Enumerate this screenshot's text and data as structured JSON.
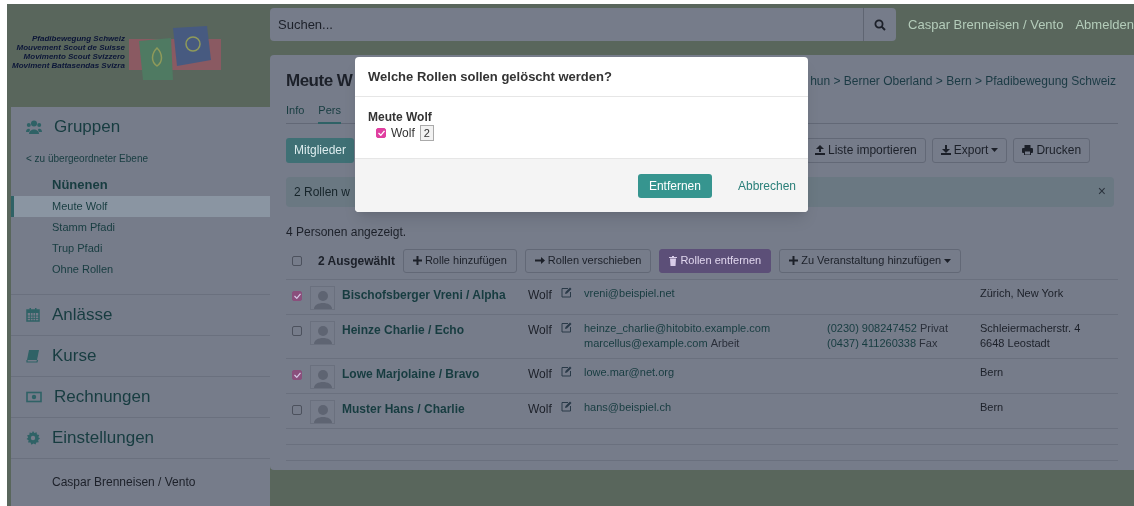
{
  "header": {
    "search_placeholder": "Suchen...",
    "user": "Caspar Brenneisen / Vento",
    "logout": "Abmelden"
  },
  "logo": {
    "lines": [
      "Pfadibewegung Schweiz",
      "Mouvement Scout de Suisse",
      "Movimento Scout Svizzero",
      "Moviment Battasendas Svizra"
    ]
  },
  "sidebar": {
    "sections": [
      {
        "kind": "groups",
        "title": "Gruppen",
        "back_link": "< zu übergeordneter Ebene",
        "items": [
          {
            "label": "Nünenen",
            "kind": "parent",
            "selected": false
          },
          {
            "label": "Meute Wolf",
            "kind": "child",
            "selected": true
          },
          {
            "label": "Stamm Pfadi",
            "kind": "child",
            "selected": false
          },
          {
            "label": "Trup Pfadi",
            "kind": "child",
            "selected": false
          },
          {
            "label": "Ohne Rollen",
            "kind": "child",
            "selected": false
          }
        ]
      },
      {
        "kind": "events",
        "title": "Anlässe"
      },
      {
        "kind": "courses",
        "title": "Kurse"
      },
      {
        "kind": "invoices",
        "title": "Rechnungen"
      },
      {
        "kind": "settings",
        "title": "Einstellungen"
      }
    ],
    "footer_user": "Caspar Brenneisen / Vento"
  },
  "main": {
    "title": "Meute W",
    "breadcrumb": "hun > Berner Oberland > Bern > Pfadibewegung Schweiz",
    "tabs": [
      {
        "label": "Info",
        "selected": false
      },
      {
        "label": "Pers",
        "selected": true
      }
    ],
    "actions": [
      {
        "label": "Mitglieder",
        "kind": "primary"
      },
      {
        "label": "Liste importieren",
        "kind": "import"
      },
      {
        "label": "Export",
        "kind": "export"
      },
      {
        "label": "Drucken",
        "kind": "print"
      }
    ],
    "alert": {
      "text": "2 Rollen w",
      "close": "×"
    },
    "count_text": "4 Personen angezeigt.",
    "bulk": {
      "selected_text": "2 Ausgewählt",
      "all_checked": false,
      "buttons": [
        {
          "label": "Rolle hinzufügen",
          "kind": "add"
        },
        {
          "label": "Rollen verschieben",
          "kind": "move"
        },
        {
          "label": "Rollen entfernen",
          "kind": "delete"
        },
        {
          "label": "Zu Veranstaltung hinzufügen",
          "kind": "dropdown"
        }
      ]
    },
    "rows": [
      {
        "checked": true,
        "name": "Bischofsberger Vreni / Alpha",
        "role": "Wolf",
        "emails": [
          {
            "address": "vreni@beispiel.net"
          }
        ],
        "phones": [],
        "address": [
          "Zürich, New York"
        ]
      },
      {
        "checked": false,
        "name": "Heinze Charlie / Echo",
        "role": "Wolf",
        "emails": [
          {
            "address": "heinze_charlie@hitobito.example.com"
          },
          {
            "address": "marcellus@example.com",
            "label": "Arbeit"
          }
        ],
        "phones": [
          {
            "number": "(0230) 908247452",
            "label": "Privat"
          },
          {
            "number": "(0437) 411260338",
            "label": "Fax"
          }
        ],
        "address": [
          "Schleiermacherstr. 4",
          "6648 Leostadt"
        ]
      },
      {
        "checked": true,
        "name": "Lowe Marjolaine / Bravo",
        "role": "Wolf",
        "emails": [
          {
            "address": "lowe.mar@net.org"
          }
        ],
        "phones": [],
        "address": [
          "Bern"
        ]
      },
      {
        "checked": false,
        "name": "Muster Hans / Charlie",
        "role": "Wolf",
        "emails": [
          {
            "address": "hans@beispiel.ch"
          }
        ],
        "phones": [],
        "address": [
          "Bern"
        ]
      }
    ]
  },
  "modal": {
    "title": "Welche Rollen sollen gelöscht werden?",
    "group": "Meute Wolf",
    "roles": [
      {
        "label": "Wolf",
        "count": "2",
        "checked": true
      }
    ],
    "confirm": "Entfernen",
    "cancel": "Abbrechen"
  }
}
